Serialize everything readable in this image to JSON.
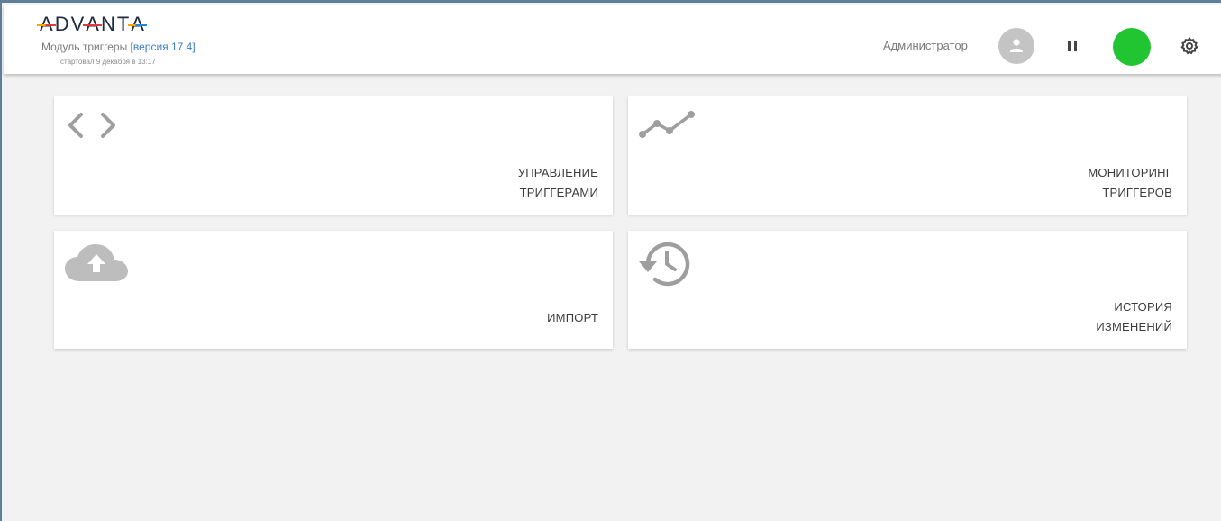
{
  "header": {
    "logo": {
      "letters": [
        "A",
        "D",
        "V",
        "A",
        "N",
        "T",
        "A"
      ],
      "accent_colors": [
        "#f2a900",
        "#e53935",
        "#1e88e5"
      ]
    },
    "module_prefix": "Модуль триггеры ",
    "module_version": "[версия 17.4]",
    "started_text": "стартовал 9 декабря в 13:17",
    "user_name": "Администратор",
    "status_color": "#21c531",
    "icons": {
      "avatar": "person-icon",
      "pause": "pause-icon",
      "settings": "gear-icon"
    }
  },
  "tiles": [
    {
      "icon": "code-brackets-icon",
      "label_line1": "УПРАВЛЕНИЕ",
      "label_line2": "ТРИГГЕРАМИ"
    },
    {
      "icon": "line-chart-icon",
      "label_line1": "МОНИТОРИНГ",
      "label_line2": "ТРИГГЕРОВ"
    },
    {
      "icon": "cloud-upload-icon",
      "label_line1": "",
      "label_line2": "ИМПОРТ"
    },
    {
      "icon": "history-icon",
      "label_line1": "ИСТОРИЯ",
      "label_line2": "ИЗМЕНЕНИЙ"
    }
  ]
}
